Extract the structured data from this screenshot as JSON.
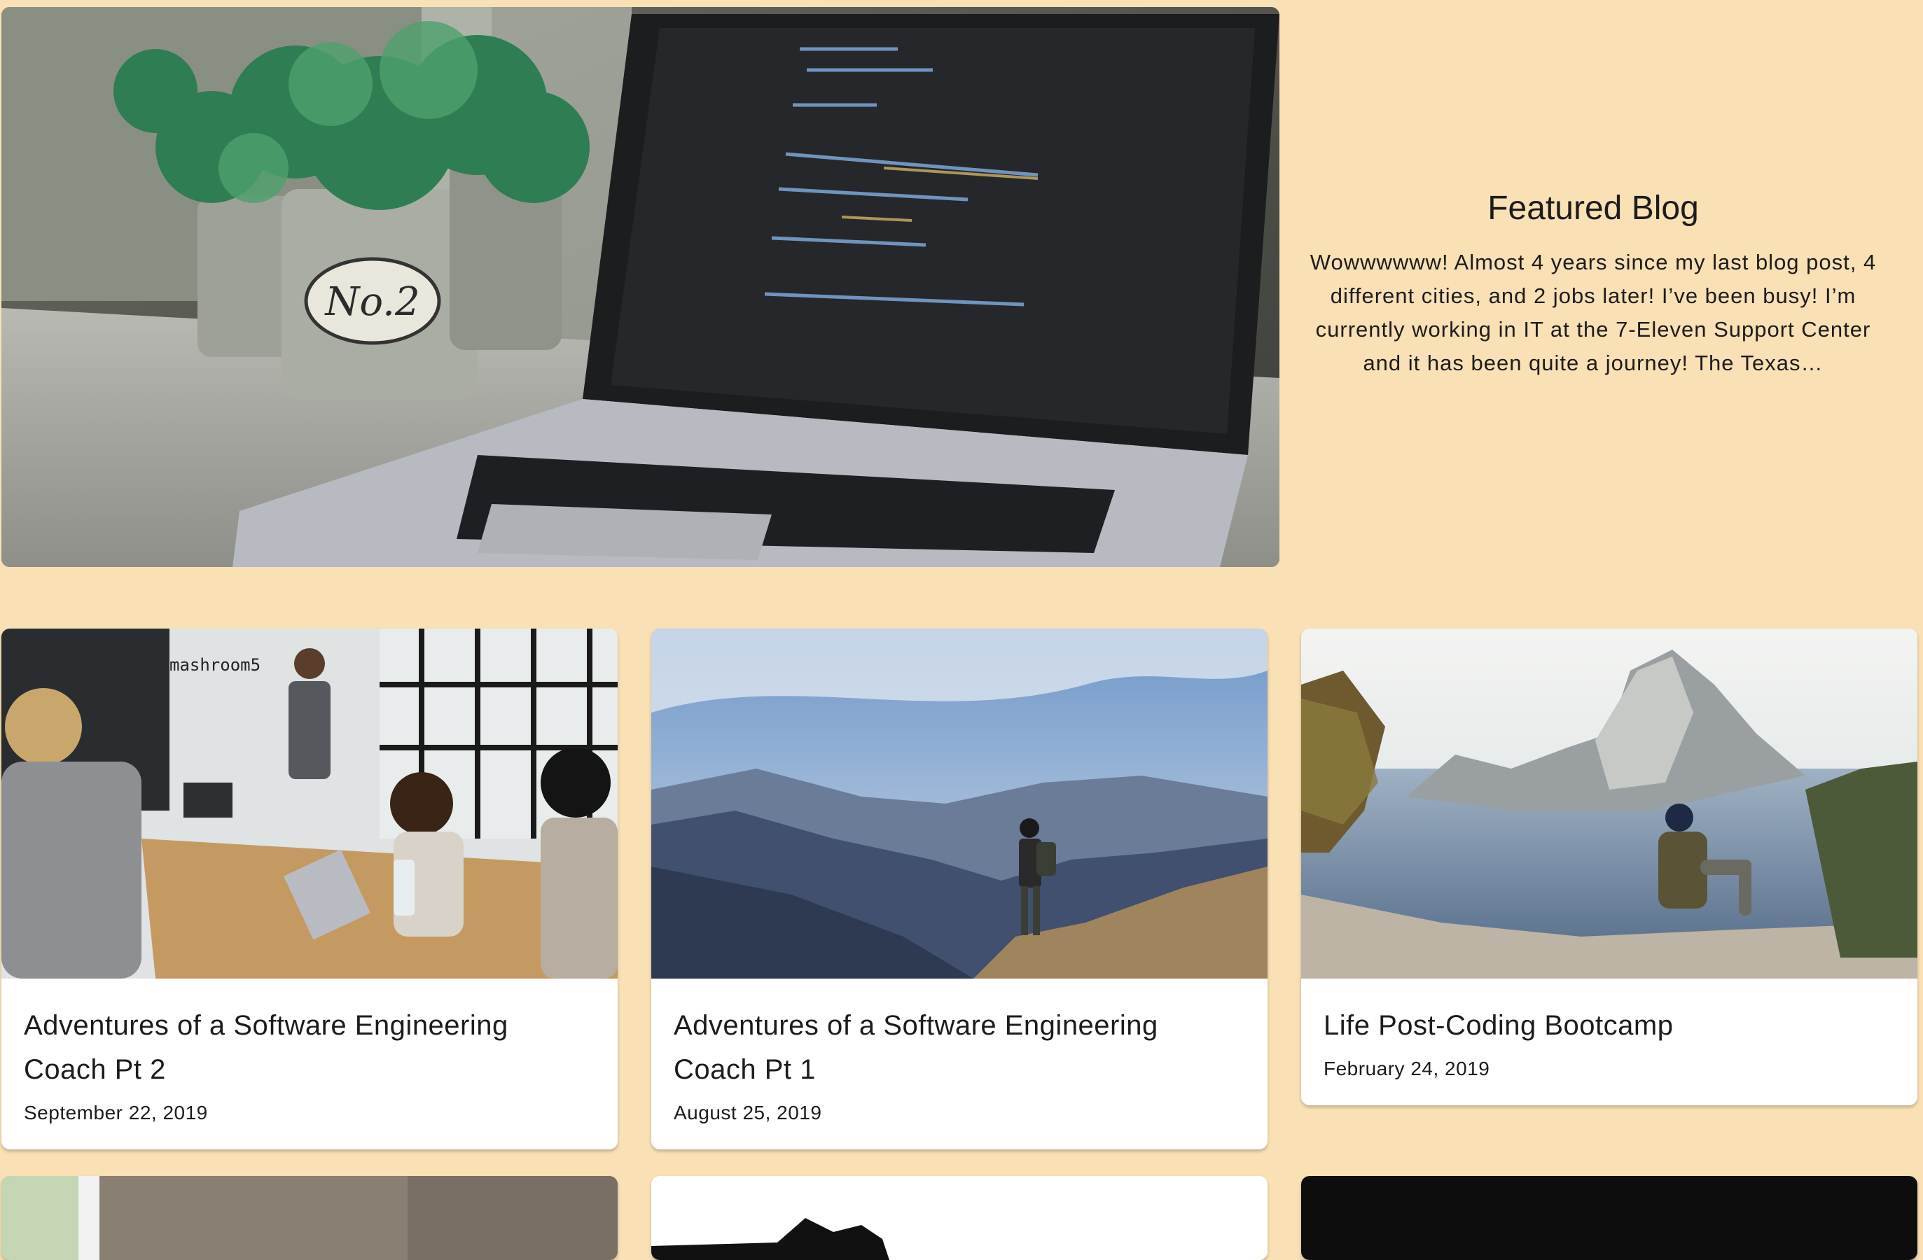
{
  "featured": {
    "title": "Featured Blog",
    "excerpt": "Wowwwwww! Almost 4 years since my last blog post, 4 different cities, and 2 jobs later! I’ve been busy! I’m currently working in IT at the 7-Eleven Support Center and it has been quite a journey! The Texas…",
    "image_label": "No.2"
  },
  "posts": [
    {
      "title": "Adventures of a Software Engineering Coach Pt 2",
      "date": "September 22, 2019",
      "image_label": "mashroom5"
    },
    {
      "title": "Adventures of a Software Engineering Coach Pt 1",
      "date": "August 25, 2019"
    },
    {
      "title": "Life Post-Coding Bootcamp",
      "date": "February 24, 2019"
    }
  ],
  "colors": {
    "page_background": "#f9e0b5",
    "card_background": "#ffffff",
    "text": "#1c1c1c"
  }
}
